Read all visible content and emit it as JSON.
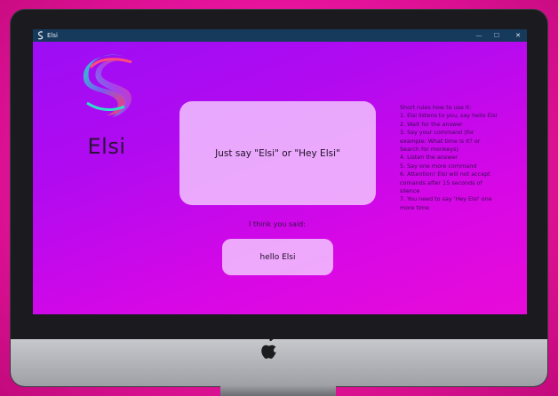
{
  "window": {
    "title": "Elsi",
    "minimize_glyph": "—",
    "maximize_glyph": "☐",
    "close_glyph": "✕"
  },
  "app": {
    "name": "Elsi",
    "prompt": "Just say \"Elsi\" or \"Hey Elsi\"",
    "heard_label": "I think you said:",
    "heard_text": "hello Elsi"
  },
  "rules": {
    "heading": "Short rules how to use it:",
    "items": [
      "1. Elsi listens to you, say hello Elsi",
      "2. Wait for the answer",
      "3. Say your command (for example: What time is it? or Search for monkeys)",
      "4. Listen the answer",
      "5. Say one more command",
      "6. Attention! Elsi will not accept comands after 15 seconds of silence",
      "7. You need to say 'Hey Elsi' one more time"
    ]
  },
  "colors": {
    "titlebar": "#163a5c",
    "card": "#f2c4ff",
    "screen_start": "#9a0ef5",
    "screen_end": "#e80bd8"
  },
  "icons": {
    "app": "elsi-logo-icon",
    "device": "apple-logo-icon"
  }
}
